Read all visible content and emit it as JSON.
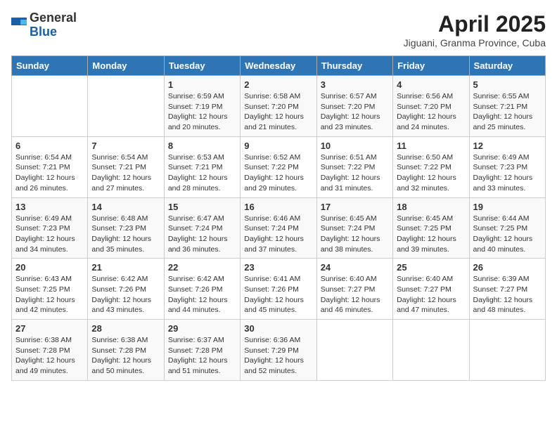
{
  "logo": {
    "general": "General",
    "blue": "Blue"
  },
  "title": "April 2025",
  "subtitle": "Jiguani, Granma Province, Cuba",
  "weekdays": [
    "Sunday",
    "Monday",
    "Tuesday",
    "Wednesday",
    "Thursday",
    "Friday",
    "Saturday"
  ],
  "weeks": [
    [
      {
        "day": "",
        "sunrise": "",
        "sunset": "",
        "daylight": ""
      },
      {
        "day": "",
        "sunrise": "",
        "sunset": "",
        "daylight": ""
      },
      {
        "day": "1",
        "sunrise": "Sunrise: 6:59 AM",
        "sunset": "Sunset: 7:19 PM",
        "daylight": "Daylight: 12 hours and 20 minutes."
      },
      {
        "day": "2",
        "sunrise": "Sunrise: 6:58 AM",
        "sunset": "Sunset: 7:20 PM",
        "daylight": "Daylight: 12 hours and 21 minutes."
      },
      {
        "day": "3",
        "sunrise": "Sunrise: 6:57 AM",
        "sunset": "Sunset: 7:20 PM",
        "daylight": "Daylight: 12 hours and 23 minutes."
      },
      {
        "day": "4",
        "sunrise": "Sunrise: 6:56 AM",
        "sunset": "Sunset: 7:20 PM",
        "daylight": "Daylight: 12 hours and 24 minutes."
      },
      {
        "day": "5",
        "sunrise": "Sunrise: 6:55 AM",
        "sunset": "Sunset: 7:21 PM",
        "daylight": "Daylight: 12 hours and 25 minutes."
      }
    ],
    [
      {
        "day": "6",
        "sunrise": "Sunrise: 6:54 AM",
        "sunset": "Sunset: 7:21 PM",
        "daylight": "Daylight: 12 hours and 26 minutes."
      },
      {
        "day": "7",
        "sunrise": "Sunrise: 6:54 AM",
        "sunset": "Sunset: 7:21 PM",
        "daylight": "Daylight: 12 hours and 27 minutes."
      },
      {
        "day": "8",
        "sunrise": "Sunrise: 6:53 AM",
        "sunset": "Sunset: 7:21 PM",
        "daylight": "Daylight: 12 hours and 28 minutes."
      },
      {
        "day": "9",
        "sunrise": "Sunrise: 6:52 AM",
        "sunset": "Sunset: 7:22 PM",
        "daylight": "Daylight: 12 hours and 29 minutes."
      },
      {
        "day": "10",
        "sunrise": "Sunrise: 6:51 AM",
        "sunset": "Sunset: 7:22 PM",
        "daylight": "Daylight: 12 hours and 31 minutes."
      },
      {
        "day": "11",
        "sunrise": "Sunrise: 6:50 AM",
        "sunset": "Sunset: 7:22 PM",
        "daylight": "Daylight: 12 hours and 32 minutes."
      },
      {
        "day": "12",
        "sunrise": "Sunrise: 6:49 AM",
        "sunset": "Sunset: 7:23 PM",
        "daylight": "Daylight: 12 hours and 33 minutes."
      }
    ],
    [
      {
        "day": "13",
        "sunrise": "Sunrise: 6:49 AM",
        "sunset": "Sunset: 7:23 PM",
        "daylight": "Daylight: 12 hours and 34 minutes."
      },
      {
        "day": "14",
        "sunrise": "Sunrise: 6:48 AM",
        "sunset": "Sunset: 7:23 PM",
        "daylight": "Daylight: 12 hours and 35 minutes."
      },
      {
        "day": "15",
        "sunrise": "Sunrise: 6:47 AM",
        "sunset": "Sunset: 7:24 PM",
        "daylight": "Daylight: 12 hours and 36 minutes."
      },
      {
        "day": "16",
        "sunrise": "Sunrise: 6:46 AM",
        "sunset": "Sunset: 7:24 PM",
        "daylight": "Daylight: 12 hours and 37 minutes."
      },
      {
        "day": "17",
        "sunrise": "Sunrise: 6:45 AM",
        "sunset": "Sunset: 7:24 PM",
        "daylight": "Daylight: 12 hours and 38 minutes."
      },
      {
        "day": "18",
        "sunrise": "Sunrise: 6:45 AM",
        "sunset": "Sunset: 7:25 PM",
        "daylight": "Daylight: 12 hours and 39 minutes."
      },
      {
        "day": "19",
        "sunrise": "Sunrise: 6:44 AM",
        "sunset": "Sunset: 7:25 PM",
        "daylight": "Daylight: 12 hours and 40 minutes."
      }
    ],
    [
      {
        "day": "20",
        "sunrise": "Sunrise: 6:43 AM",
        "sunset": "Sunset: 7:25 PM",
        "daylight": "Daylight: 12 hours and 42 minutes."
      },
      {
        "day": "21",
        "sunrise": "Sunrise: 6:42 AM",
        "sunset": "Sunset: 7:26 PM",
        "daylight": "Daylight: 12 hours and 43 minutes."
      },
      {
        "day": "22",
        "sunrise": "Sunrise: 6:42 AM",
        "sunset": "Sunset: 7:26 PM",
        "daylight": "Daylight: 12 hours and 44 minutes."
      },
      {
        "day": "23",
        "sunrise": "Sunrise: 6:41 AM",
        "sunset": "Sunset: 7:26 PM",
        "daylight": "Daylight: 12 hours and 45 minutes."
      },
      {
        "day": "24",
        "sunrise": "Sunrise: 6:40 AM",
        "sunset": "Sunset: 7:27 PM",
        "daylight": "Daylight: 12 hours and 46 minutes."
      },
      {
        "day": "25",
        "sunrise": "Sunrise: 6:40 AM",
        "sunset": "Sunset: 7:27 PM",
        "daylight": "Daylight: 12 hours and 47 minutes."
      },
      {
        "day": "26",
        "sunrise": "Sunrise: 6:39 AM",
        "sunset": "Sunset: 7:27 PM",
        "daylight": "Daylight: 12 hours and 48 minutes."
      }
    ],
    [
      {
        "day": "27",
        "sunrise": "Sunrise: 6:38 AM",
        "sunset": "Sunset: 7:28 PM",
        "daylight": "Daylight: 12 hours and 49 minutes."
      },
      {
        "day": "28",
        "sunrise": "Sunrise: 6:38 AM",
        "sunset": "Sunset: 7:28 PM",
        "daylight": "Daylight: 12 hours and 50 minutes."
      },
      {
        "day": "29",
        "sunrise": "Sunrise: 6:37 AM",
        "sunset": "Sunset: 7:28 PM",
        "daylight": "Daylight: 12 hours and 51 minutes."
      },
      {
        "day": "30",
        "sunrise": "Sunrise: 6:36 AM",
        "sunset": "Sunset: 7:29 PM",
        "daylight": "Daylight: 12 hours and 52 minutes."
      },
      {
        "day": "",
        "sunrise": "",
        "sunset": "",
        "daylight": ""
      },
      {
        "day": "",
        "sunrise": "",
        "sunset": "",
        "daylight": ""
      },
      {
        "day": "",
        "sunrise": "",
        "sunset": "",
        "daylight": ""
      }
    ]
  ]
}
